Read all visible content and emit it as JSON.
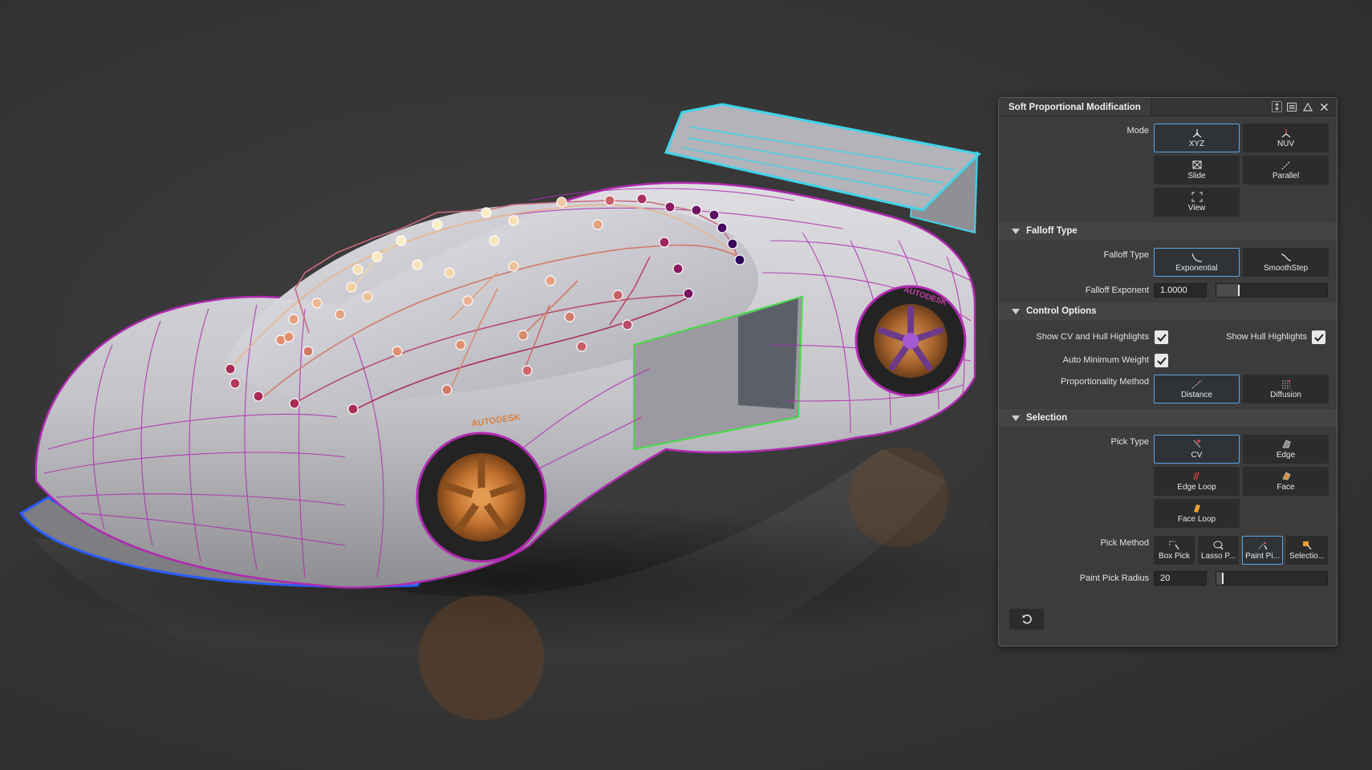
{
  "viewport": {
    "tire_brand": "AUTODESK",
    "colors": {
      "background": "#393939",
      "car_body": "#c8c8cc",
      "wireframe": "#b02ab0",
      "spoiler_edge": "#3fd4e8",
      "splitter_edge": "#2a5cff",
      "door_edge": "#44dd44",
      "wheel": "#d98a3c"
    }
  },
  "panel": {
    "title": "Soft Proportional Modification",
    "title_icons": [
      "pin-icon",
      "menu-icon",
      "collapse-icon",
      "close-icon"
    ],
    "mode": {
      "label": "Mode",
      "buttons": [
        {
          "label": "XYZ",
          "icon": "xyz-axes-icon",
          "selected": true
        },
        {
          "label": "NUV",
          "icon": "nuv-axes-icon",
          "selected": false
        },
        {
          "label": "Slide",
          "icon": "slide-icon",
          "selected": false
        },
        {
          "label": "Parallel",
          "icon": "parallel-icon",
          "selected": false
        },
        {
          "label": "View",
          "icon": "view-frame-icon",
          "selected": false
        }
      ]
    },
    "falloff": {
      "section_title": "Falloff Type",
      "type_label": "Falloff Type",
      "types": [
        {
          "label": "Exponential",
          "icon": "exponential-curve-icon",
          "selected": true
        },
        {
          "label": "SmoothStep",
          "icon": "smoothstep-curve-icon",
          "selected": false
        }
      ],
      "exponent_label": "Falloff Exponent",
      "exponent_value": "1.0000",
      "exponent_slider_fraction": 0.2
    },
    "control": {
      "section_title": "Control Options",
      "show_cv_label": "Show CV and Hull Highlights",
      "show_cv_checked": true,
      "show_hull_label": "Show Hull Highlights",
      "show_hull_checked": true,
      "auto_min_label": "Auto Minimum Weight",
      "auto_min_checked": true,
      "prop_method_label": "Proportionality Method",
      "methods": [
        {
          "label": "Distance",
          "icon": "distance-icon",
          "selected": true
        },
        {
          "label": "Diffusion",
          "icon": "diffusion-icon",
          "selected": false
        }
      ]
    },
    "selection": {
      "section_title": "Selection",
      "pick_type_label": "Pick Type",
      "pick_types": [
        {
          "label": "CV",
          "icon": "cv-pick-icon",
          "selected": true
        },
        {
          "label": "Edge",
          "icon": "edge-pick-icon",
          "selected": false
        },
        {
          "label": "Edge Loop",
          "icon": "edge-loop-icon",
          "selected": false
        },
        {
          "label": "Face",
          "icon": "face-pick-icon",
          "selected": false
        },
        {
          "label": "Face Loop",
          "icon": "face-loop-icon",
          "selected": false
        }
      ],
      "pick_method_label": "Pick Method",
      "pick_methods": [
        {
          "label": "Box Pick",
          "icon": "box-pick-icon",
          "selected": false
        },
        {
          "label": "Lasso P...",
          "icon": "lasso-icon",
          "selected": false
        },
        {
          "label": "Paint Pi...",
          "icon": "paint-pick-icon",
          "selected": true
        },
        {
          "label": "Selectio...",
          "icon": "selection-set-icon",
          "selected": false
        }
      ],
      "radius_label": "Paint Pick Radius",
      "radius_value": "20",
      "radius_slider_fraction": 0.06
    },
    "reset_icon": "reset-icon"
  }
}
